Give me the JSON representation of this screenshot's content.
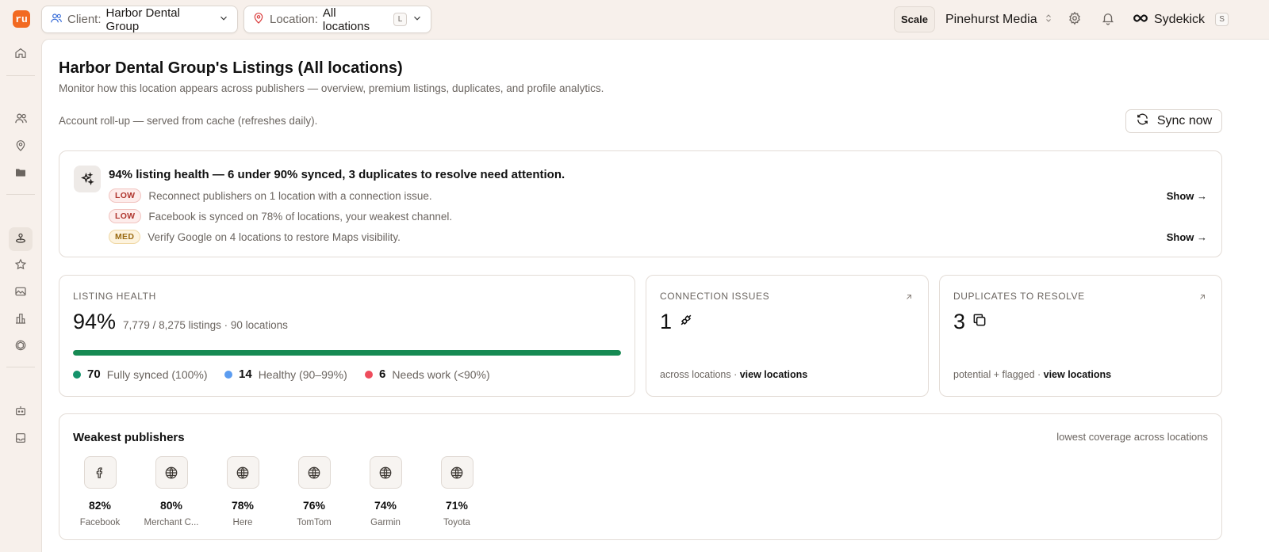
{
  "topbar": {
    "logo_text": "ru",
    "client_label": "Client:",
    "client_value": "Harbor Dental Group",
    "location_label": "Location:",
    "location_value": "All locations",
    "location_kbd": "L",
    "plan_label": "Scale",
    "workspace": "Pinehurst Media",
    "assistant_label": "Sydekick",
    "assistant_kbd": "S"
  },
  "page": {
    "title": "Harbor Dental Group's Listings (All locations)",
    "subtitle": "Monitor how this location appears across publishers — overview, premium listings, duplicates, and profile analytics.",
    "rollup_note": "Account roll-up — served from cache (refreshes daily).",
    "sync_button": "Sync now"
  },
  "insights": {
    "headline": "94% listing health — 6 under 90% synced, 3 duplicates to resolve need attention.",
    "items": [
      {
        "severity": "LOW",
        "text": "Reconnect publishers on 1 location with a connection issue.",
        "action": "Show →"
      },
      {
        "severity": "LOW",
        "text": "Facebook is synced on 78% of locations, your weakest channel.",
        "action": ""
      },
      {
        "severity": "MED",
        "text": "Verify Google on 4 locations to restore Maps visibility.",
        "action": "Show →"
      }
    ]
  },
  "listing_health": {
    "caption": "LISTING HEALTH",
    "percent": "94%",
    "detail": "7,779 / 8,275 listings · 90 locations",
    "progress_fraction": 1.0,
    "legend": [
      {
        "count": "70",
        "label": "Fully synced (100%)",
        "color": "#14936b"
      },
      {
        "count": "14",
        "label": "Healthy (90–99%)",
        "color": "#5b9cf0"
      },
      {
        "count": "6",
        "label": "Needs work (<90%)",
        "color": "#ee4c5c"
      }
    ]
  },
  "connection_issues": {
    "caption": "CONNECTION ISSUES",
    "value": "1",
    "footer_text": "across locations · ",
    "footer_link": "view locations"
  },
  "duplicates": {
    "caption": "DUPLICATES TO RESOLVE",
    "value": "3",
    "footer_text": "potential + flagged · ",
    "footer_link": "view locations"
  },
  "weakest": {
    "title": "Weakest publishers",
    "note": "lowest coverage across locations",
    "publishers": [
      {
        "pct": "82%",
        "name": "Facebook",
        "icon": "facebook-icon"
      },
      {
        "pct": "80%",
        "name": "Merchant C...",
        "icon": "globe-icon"
      },
      {
        "pct": "78%",
        "name": "Here",
        "icon": "globe-icon"
      },
      {
        "pct": "76%",
        "name": "TomTom",
        "icon": "globe-icon"
      },
      {
        "pct": "74%",
        "name": "Garmin",
        "icon": "globe-icon"
      },
      {
        "pct": "71%",
        "name": "Toyota",
        "icon": "globe-icon"
      }
    ]
  },
  "colors": {
    "brand": "#f26a21",
    "progress": "#168a53"
  }
}
